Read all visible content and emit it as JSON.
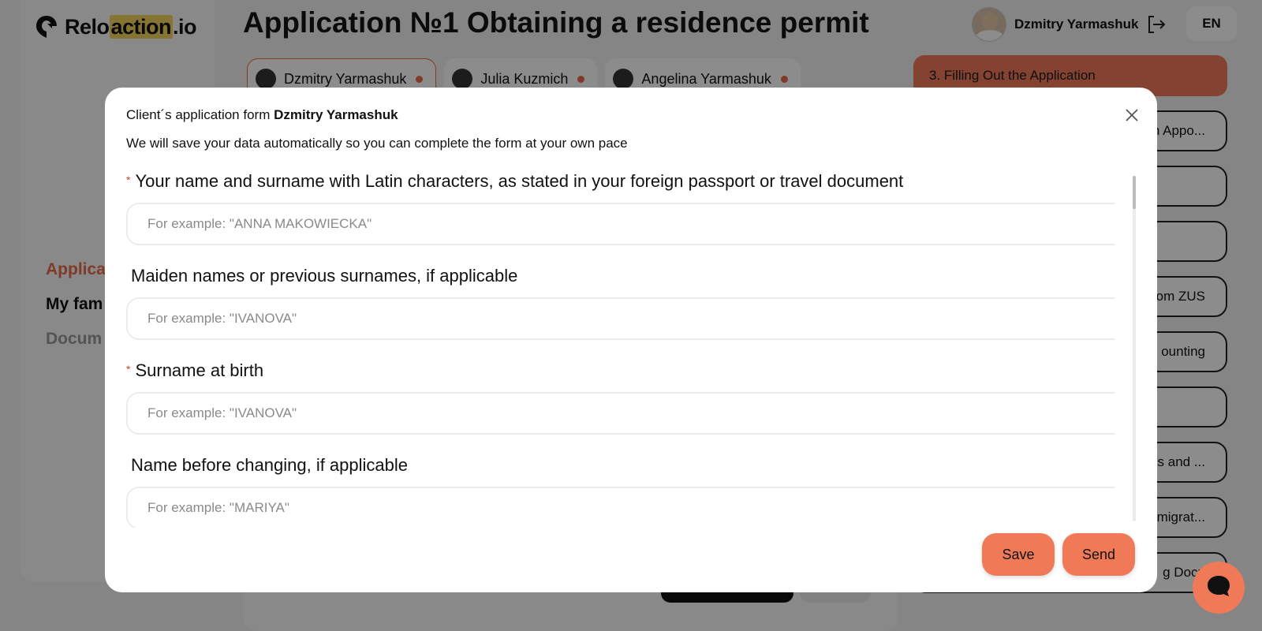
{
  "brand": {
    "logo_prefix": "Relo",
    "logo_highlight": "action",
    "logo_suffix": ".io",
    "highlight_color": "#f4d35e"
  },
  "header": {
    "title": "Application №1 Obtaining a residence permit",
    "user_name": "Dzmitry Yarmashuk",
    "language": "EN"
  },
  "sidebar": {
    "items": [
      {
        "label": "Applica"
      },
      {
        "label": "My fam"
      },
      {
        "label": "Docum"
      }
    ]
  },
  "family_tabs": [
    {
      "label": "Dzmitry Yarmashuk"
    },
    {
      "label": "Julia Kuzmich"
    },
    {
      "label": "Angelina Yarmashuk"
    }
  ],
  "steps": {
    "active": "3. Filling Out the Application",
    "items": [
      "n Appo...",
      "",
      "",
      "om ZUS",
      "ounting",
      "",
      "ts and ...",
      "migrat...",
      "g Docu"
    ]
  },
  "modal": {
    "title_prefix": "Client´s application form ",
    "title_name": "Dzmitry Yarmashuk",
    "subtitle": "We will save your data automatically so you can complete the form at your own pace",
    "fields": [
      {
        "label": "Your name and surname with Latin characters, as stated in your foreign passport or travel document",
        "required": "*",
        "placeholder": "For example: \"ANNA MAKOWIECKA\""
      },
      {
        "label": "Maiden names or previous surnames, if applicable",
        "required": "",
        "placeholder": "For example: \"IVANOVA\""
      },
      {
        "label": "Surname at birth",
        "required": "*",
        "placeholder": "For example: \"IVANOVA\""
      },
      {
        "label": "Name before changing, if applicable",
        "required": "",
        "placeholder": "For example: \"MARIYA\""
      }
    ],
    "save_label": "Save",
    "send_label": "Send"
  },
  "colors": {
    "accent": "#f07a58",
    "required": "#e0442b"
  },
  "icons": {
    "close": "close-icon",
    "logout": "logout-icon",
    "chat": "chat-icon"
  }
}
